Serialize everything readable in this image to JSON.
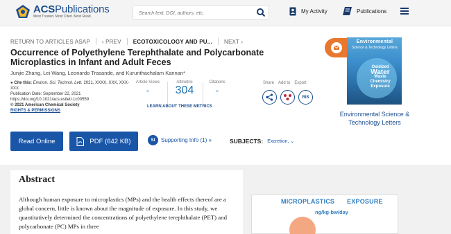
{
  "header": {
    "logo_title_bold": "ACS",
    "logo_title_rest": "Publications",
    "logo_tagline": "Most Trusted. Most Cited. Most Read.",
    "search_placeholder": "Search text, DOI, authors, etc.",
    "my_activity": "My Activity",
    "publications": "Publications"
  },
  "nav": {
    "return": "RETURN TO ARTICLES ASAP",
    "prev": "‹ PREV",
    "current": "ECOTOXICOLOGY AND PU...",
    "next": "NEXT ›"
  },
  "article": {
    "title": "Occurrence of Polyethylene Terephthalate and Polycarbonate Microplastics in Infant and Adult Feces",
    "authors": "Junjie Zhang, Lei Wang, Leonardo Trasande, and Kurunthachalam Kannan*",
    "cite_label": "Cite this:",
    "cite_journal": "Environ. Sci. Technol. Lett.",
    "cite_rest": "2021, XXXX, XXX, XXX-XXX",
    "pub_date": "Publication Date: September 22, 2021",
    "doi": "https://doi.org/10.1021/acs.estlett.1c00559",
    "copyright": "© 2021 American Chemical Society",
    "rights": "RIGHTS & PERMISSIONS"
  },
  "metrics": {
    "views_label": "Article Views",
    "views_value": "-",
    "altmetric_label": "Altmetric",
    "altmetric_value": "304",
    "citations_label": "Citations",
    "citations_value": "-",
    "learn_more": "LEARN ABOUT THESE METRICS"
  },
  "share": {
    "share_label": "Share",
    "add_label": "Add to",
    "export_label": "Export",
    "ris_label": "RIS"
  },
  "journal": {
    "cover_title": "Environmental",
    "cover_title2": "Science & Technology Letters",
    "cover_word1": "Oxidized",
    "cover_word2": "Water",
    "cover_word3": "Waste",
    "cover_word4": "Chemistry",
    "cover_word5": "Exposure",
    "name": "Environmental Science & Technology Letters"
  },
  "actions": {
    "read_online": "Read Online",
    "pdf": "PDF (642 KB)",
    "si_badge": "SI",
    "supporting_info": "Supporting Info (1) »",
    "subjects_label": "SUBJECTS:",
    "subjects_value": "Excretion, ⌄"
  },
  "abstract": {
    "heading": "Abstract",
    "text": "Although human exposure to microplastics (MPs) and the health effects thereof are a global concern, little is known about the magnitude of exposure. In this study, we quantitatively determined the concentrations of polyethylene terephthalate (PET) and polycarbonate (PC) MPs in three",
    "toc_word1": "MICROPLASTICS",
    "toc_word2": "EXPOSURE",
    "toc_unit": "ng/kg-bw/day"
  },
  "colors": {
    "brand_blue": "#1a56a8",
    "link_blue": "#1a4d8f",
    "accent_orange": "#e8782f"
  }
}
